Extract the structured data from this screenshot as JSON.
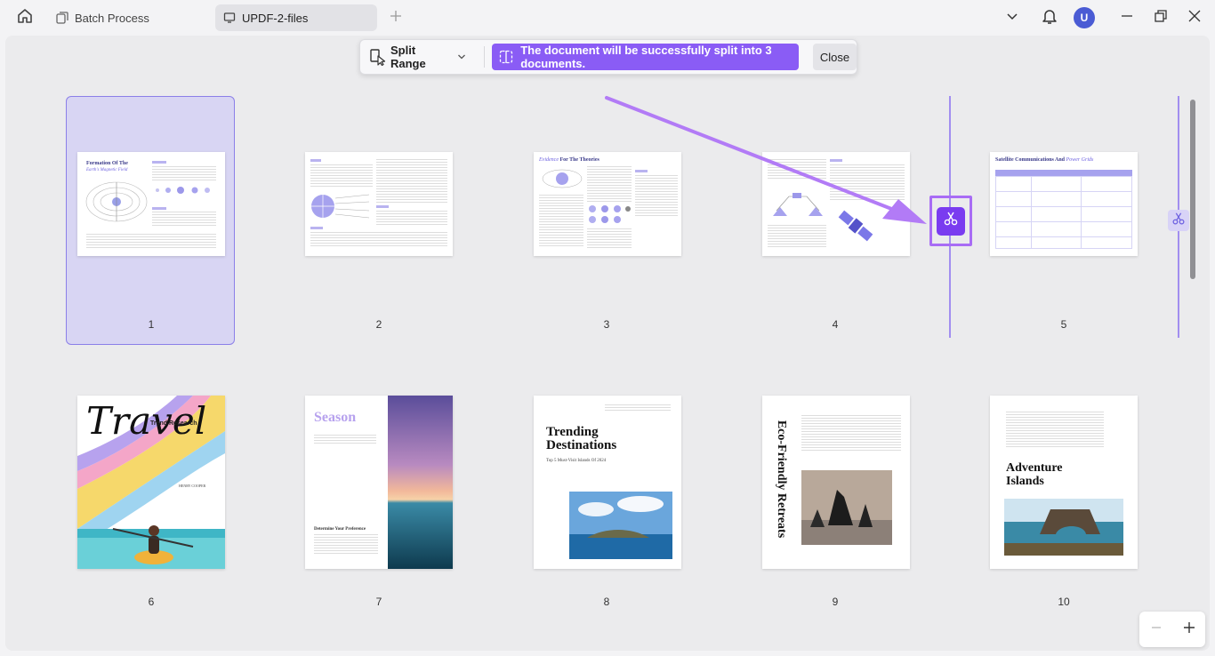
{
  "titlebar": {
    "tabs": [
      {
        "label": "Batch Process",
        "icon": "batch-icon"
      },
      {
        "label": "UPDF-2-files",
        "icon": "document-icon"
      }
    ],
    "avatar_letter": "U"
  },
  "split_toolbar": {
    "mode_label": "Split Range",
    "message": "The document will be successfully split into 3 documents.",
    "close_label": "Close"
  },
  "pages": [
    {
      "number": "1",
      "title": "Formation Of The",
      "subtitle": "Earth's Magnetic Field"
    },
    {
      "number": "2"
    },
    {
      "number": "3",
      "title_a": "Evidence",
      "title_b": "For The Theories"
    },
    {
      "number": "4"
    },
    {
      "number": "5",
      "title_a": "Satellite Communications And",
      "title_b": "Power Grids"
    },
    {
      "number": "6",
      "title": "Travel",
      "subtitle": "Trend Research",
      "author": "HENRY COOPER"
    },
    {
      "number": "7",
      "title": "Season",
      "heading": "Determine Your Preference"
    },
    {
      "number": "8",
      "title": "Trending Destinations",
      "subtitle": "Top 5 Must-Visit Islands Of 2024"
    },
    {
      "number": "9",
      "title": "Eco-Friendly Retreats"
    },
    {
      "number": "10",
      "title": "Adventure Islands"
    }
  ],
  "colors": {
    "accent": "#8a5cf5",
    "selection": "#d8d5f3",
    "split_line": "#a28ef0"
  }
}
